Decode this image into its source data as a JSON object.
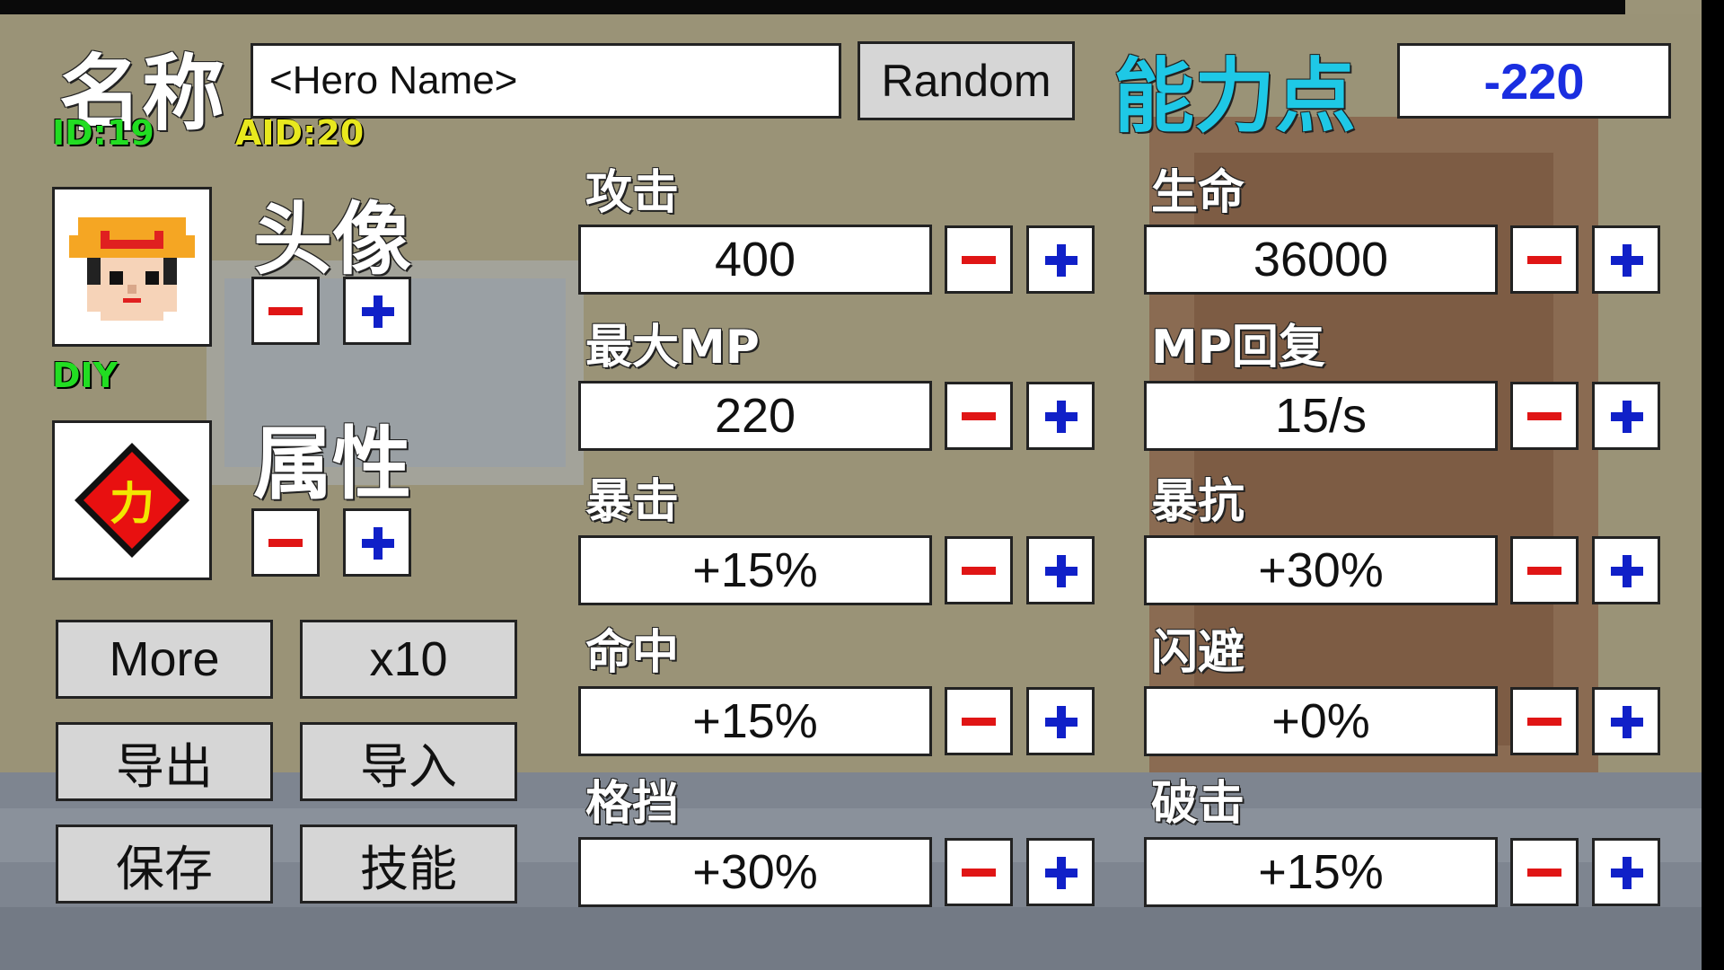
{
  "header": {
    "name_label": "名称",
    "name_placeholder": "<Hero Name>",
    "random_button": "Random",
    "points_label": "能力点",
    "points_value": "-220",
    "id_tag": "ID:19",
    "aid_tag": "AID:20"
  },
  "avatar": {
    "label": "头像",
    "tag": "DIY"
  },
  "attribute": {
    "label": "属性",
    "glyph": "力"
  },
  "buttons": {
    "more": "More",
    "x10": "x10",
    "export": "导出",
    "import": "导入",
    "save": "保存",
    "skills": "技能"
  },
  "stats": {
    "attack": {
      "label": "攻击",
      "value": "400"
    },
    "hp": {
      "label": "生命",
      "value": "36000"
    },
    "max_mp": {
      "label": "最大MP",
      "value": "220"
    },
    "mp_regen": {
      "label": "MP回复",
      "value": "15/s"
    },
    "crit": {
      "label": "暴击",
      "value": "+15%"
    },
    "crit_resist": {
      "label": "暴抗",
      "value": "+30%"
    },
    "hit": {
      "label": "命中",
      "value": "+15%"
    },
    "dodge": {
      "label": "闪避",
      "value": "+0%"
    },
    "block": {
      "label": "格挡",
      "value": "+30%"
    },
    "pierce": {
      "label": "破击",
      "value": "+15%"
    }
  },
  "colors": {
    "points_label": "#1ec8e6",
    "points_value": "#1a2ee0",
    "id_tag": "#22dd22",
    "aid_tag": "#e8e81e",
    "minus": "#e01515",
    "plus": "#1020c8"
  }
}
